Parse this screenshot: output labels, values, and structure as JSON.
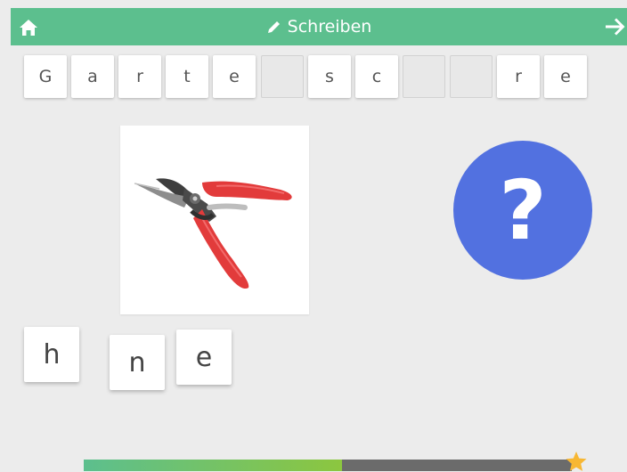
{
  "header": {
    "title": "Schreiben",
    "home_icon": "home-icon",
    "title_icon": "pencil-icon",
    "next_icon": "arrow-right-icon",
    "color": "#5cbf8e"
  },
  "word_slots": [
    {
      "letter": "G",
      "filled": true
    },
    {
      "letter": "a",
      "filled": true
    },
    {
      "letter": "r",
      "filled": true
    },
    {
      "letter": "t",
      "filled": true
    },
    {
      "letter": "e",
      "filled": true
    },
    {
      "letter": "",
      "filled": false
    },
    {
      "letter": "s",
      "filled": true
    },
    {
      "letter": "c",
      "filled": true
    },
    {
      "letter": "",
      "filled": false
    },
    {
      "letter": "",
      "filled": false
    },
    {
      "letter": "r",
      "filled": true
    },
    {
      "letter": "e",
      "filled": true
    }
  ],
  "picture": {
    "icon": "pruning-shears-image"
  },
  "help": {
    "label": "?",
    "color": "#5271e0"
  },
  "letter_choices": [
    "h",
    "n",
    "e"
  ],
  "progress": {
    "fraction": 0.53,
    "fill_color": "#8cc63f",
    "star_icon": "star-icon"
  }
}
